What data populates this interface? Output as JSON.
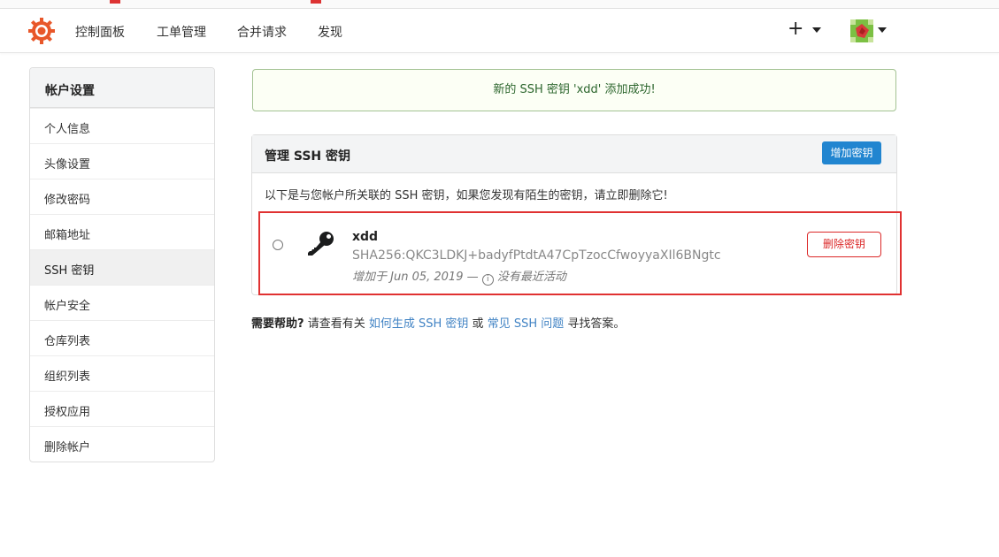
{
  "nav": {
    "items": [
      "控制面板",
      "工单管理",
      "合并请求",
      "发现"
    ],
    "plus_symbol": "+"
  },
  "sidebar": {
    "header": "帐户设置",
    "items": [
      "个人信息",
      "头像设置",
      "修改密码",
      "邮箱地址",
      "SSH 密钥",
      "帐户安全",
      "仓库列表",
      "组织列表",
      "授权应用",
      "删除帐户"
    ],
    "active_index": 4
  },
  "flash": {
    "message": "新的 SSH 密钥 'xdd' 添加成功!"
  },
  "panel": {
    "title": "管理 SSH 密钥",
    "add_button": "增加密钥",
    "notice": "以下是与您帐户所关联的 SSH 密钥，如果您发现有陌生的密钥，请立即删除它!"
  },
  "key": {
    "name": "xdd",
    "fingerprint": "SHA256:QKC3LDKJ+badyfPtdtA47CpTzocCfwoyyaXIl6BNgtc",
    "added": "增加于 Jun 05, 2019 —",
    "activity": "没有最近活动",
    "delete_button": "删除密钥"
  },
  "help": {
    "prefix": "需要帮助?",
    "text1": "请查看有关",
    "link1": "如何生成 SSH 密钥",
    "text2": "或",
    "link2": "常见 SSH 问题",
    "text3": "寻找答案。"
  },
  "colors": {
    "primary": "#2185d0",
    "danger": "#db2828",
    "success_bg": "#fcfff5",
    "success_text": "#2c662d",
    "link": "#4183c4",
    "logo": "#e8572a"
  },
  "icons": [
    "gitea-logo-icon",
    "plus-icon",
    "avatar",
    "key-icon",
    "info-icon"
  ]
}
